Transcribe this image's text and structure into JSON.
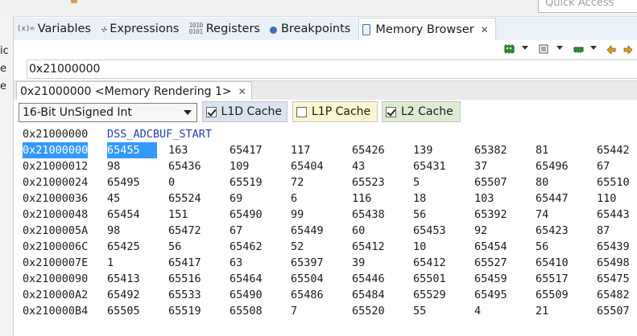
{
  "top_bar": {
    "quick_access_placeholder": "Quick Access"
  },
  "left_panel_fragments": [
    "ic",
    "e",
    "e"
  ],
  "view_tabs": [
    {
      "name": "tab-variables",
      "icon": "variables-icon",
      "glyph": "(x)=",
      "label": "Variables"
    },
    {
      "name": "tab-expressions",
      "icon": "expressions-icon",
      "glyph": "✢",
      "label": "Expressions"
    },
    {
      "name": "tab-registers",
      "icon": "registers-icon",
      "glyph": "1010\n0101",
      "label": "Registers"
    },
    {
      "name": "tab-breakpoints",
      "icon": "breakpoints-icon",
      "glyph": "",
      "label": "Breakpoints"
    },
    {
      "name": "tab-memory-browser",
      "icon": "memory-browser-icon",
      "glyph": "",
      "label": "Memory Browser",
      "active": true
    }
  ],
  "toolbar_icons": [
    "new-rendering-icon",
    "import-memory-icon",
    "export-memory-icon",
    "save-memory-icon",
    "back-icon",
    "forward-icon"
  ],
  "address_value": "0x21000000",
  "rendering_tab": {
    "label": "0x21000000 <Memory Rendering 1>"
  },
  "format": {
    "selected": "16-Bit UnSigned Int"
  },
  "caches": [
    {
      "label": "L1D Cache",
      "checked": true,
      "color": "#d9e4ee"
    },
    {
      "label": "L1P Cache",
      "checked": false,
      "color": "#fbf6d0"
    },
    {
      "label": "L2 Cache",
      "checked": true,
      "color": "#dcecd2"
    }
  ],
  "colors": {
    "selection": "#3399ff",
    "symbol_label": "#1f3fbf"
  },
  "memory": {
    "label_row": {
      "address": "0x21000000",
      "symbol": "DSS_ADCBUF_START"
    },
    "rows": [
      {
        "address": "0x21000000",
        "values": [
          "65455",
          "163",
          "65417",
          "117",
          "65426",
          "139",
          "65382",
          "81",
          "65442"
        ],
        "selected": true
      },
      {
        "address": "0x21000012",
        "values": [
          "98",
          "65436",
          "109",
          "65404",
          "43",
          "65431",
          "37",
          "65496",
          "67"
        ]
      },
      {
        "address": "0x21000024",
        "values": [
          "65495",
          "0",
          "65519",
          "72",
          "65523",
          "5",
          "65507",
          "80",
          "65510"
        ]
      },
      {
        "address": "0x21000036",
        "values": [
          "45",
          "65524",
          "69",
          "6",
          "116",
          "18",
          "103",
          "65447",
          "110"
        ]
      },
      {
        "address": "0x21000048",
        "values": [
          "65454",
          "151",
          "65490",
          "99",
          "65438",
          "56",
          "65392",
          "74",
          "65443"
        ]
      },
      {
        "address": "0x2100005A",
        "values": [
          "98",
          "65472",
          "67",
          "65449",
          "60",
          "65453",
          "92",
          "65423",
          "87"
        ]
      },
      {
        "address": "0x2100006C",
        "values": [
          "65425",
          "56",
          "65462",
          "52",
          "65412",
          "10",
          "65454",
          "56",
          "65439"
        ]
      },
      {
        "address": "0x2100007E",
        "values": [
          "1",
          "65417",
          "63",
          "65397",
          "39",
          "65412",
          "65527",
          "65410",
          "65498"
        ]
      },
      {
        "address": "0x21000090",
        "values": [
          "65413",
          "65516",
          "65464",
          "65504",
          "65446",
          "65501",
          "65459",
          "65517",
          "65475"
        ]
      },
      {
        "address": "0x210000A2",
        "values": [
          "65492",
          "65533",
          "65490",
          "65486",
          "65484",
          "65529",
          "65495",
          "65509",
          "65482"
        ]
      },
      {
        "address": "0x210000B4",
        "values": [
          "65505",
          "65519",
          "65508",
          "7",
          "65520",
          "55",
          "4",
          "21",
          "65507"
        ]
      }
    ]
  }
}
